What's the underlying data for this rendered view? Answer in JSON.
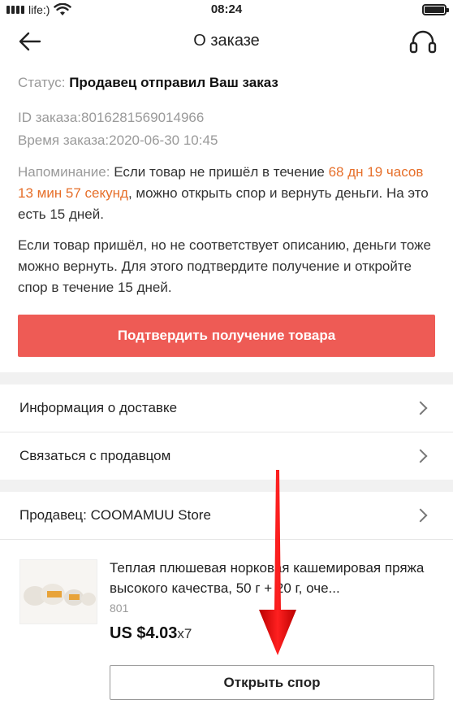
{
  "statusbar": {
    "carrier": "life:)",
    "time": "08:24"
  },
  "header": {
    "title": "О заказе",
    "back_icon": "back-arrow-icon",
    "support_icon": "headset-icon"
  },
  "order": {
    "status_label": "Статус:",
    "status_value": "Продавец отправил Ваш заказ",
    "id_label": "ID заказа:",
    "id_value": "8016281569014966",
    "time_label": "Время заказа:",
    "time_value": "2020-06-30 10:45"
  },
  "reminder": {
    "label": "Напоминание:",
    "text_before": " Если товар не пришёл в течение ",
    "countdown": "68 дн 19 часов 13 мин 57 секунд",
    "text_after": ", можно открыть спор и вернуть деньги. На это есть 15 дней.",
    "paragraph2": "Если товар пришёл, но не соответствует описанию, деньги тоже можно вернуть. Для этого подтвердите получение и откройте спор в течение 15 дней."
  },
  "actions": {
    "confirm_label": "Подтвердить получение товара",
    "dispute_label": "Открыть спор"
  },
  "menu": {
    "delivery_info": "Информация о доставке",
    "contact_seller": "Связаться с продавцом"
  },
  "seller": {
    "label": "Продавец: COOMAMUU Store"
  },
  "product": {
    "title": "Теплая плюшевая норковая кашемировая пряжа высокого качества, 50 г + 20 г, оче...",
    "sku": "801",
    "price": "US $4.03",
    "quantity": "x7"
  },
  "colors": {
    "accent": "#ee5b55",
    "countdown": "#e66f2a",
    "annotation_arrow": "#e01010"
  }
}
